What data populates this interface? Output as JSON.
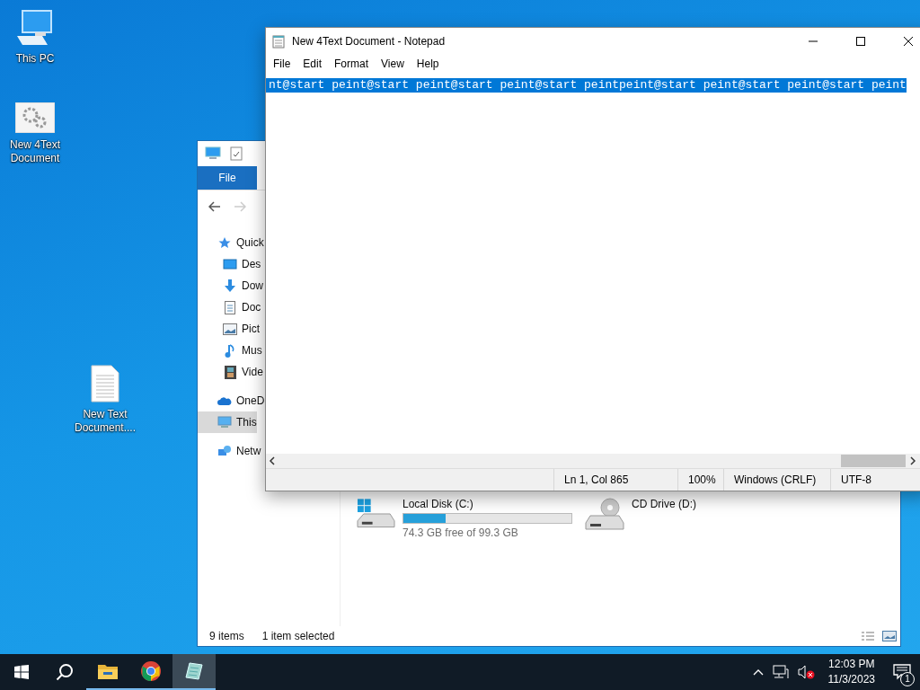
{
  "desktop_icons": [
    {
      "label": "This PC",
      "kind": "pc"
    },
    {
      "label": "New 4Text Document",
      "kind": "settings-file"
    },
    {
      "label": "New Text Document....",
      "kind": "text-file"
    }
  ],
  "explorer": {
    "ribbon_tabs": [
      {
        "label": "File",
        "selected": true
      }
    ],
    "nav_items": [
      {
        "label": "Quick",
        "kind": "star",
        "selected": false,
        "children": [
          {
            "label": "Des",
            "kind": "desktop",
            "selected": false
          },
          {
            "label": "Dow",
            "kind": "download",
            "selected": false
          },
          {
            "label": "Doc",
            "kind": "document",
            "selected": false
          },
          {
            "label": "Pict",
            "kind": "pictures",
            "selected": false
          },
          {
            "label": "Mus",
            "kind": "music",
            "selected": false
          },
          {
            "label": "Vide",
            "kind": "video",
            "selected": false
          }
        ]
      },
      {
        "label": "OneD",
        "kind": "cloud",
        "selected": false
      },
      {
        "label": "This",
        "kind": "pc",
        "selected": true
      },
      {
        "label": "Netw",
        "kind": "network",
        "selected": false
      }
    ],
    "drives": [
      {
        "name": "Local Disk (C:)",
        "kind": "disk",
        "level": 0.25,
        "free": "74.3 GB free of 99.3 GB"
      },
      {
        "name": "CD Drive (D:)",
        "kind": "cd"
      }
    ],
    "status_bar": {
      "count": "9 items",
      "selection": "1 item selected"
    }
  },
  "notepad": {
    "title": "New 4Text Document - Notepad",
    "menu": [
      "File",
      "Edit",
      "Format",
      "View",
      "Help"
    ],
    "text": "nt@start peint@start peint@start peint@start peintpeint@start peint@start peint@start peint",
    "text_selected": true,
    "status": {
      "position": "Ln 1, Col 865",
      "zoom": "100%",
      "line_ending": "Windows (CRLF)",
      "encoding": "UTF-8"
    }
  },
  "taskbar": {
    "apps": [
      {
        "kind": "explorer",
        "active": false
      },
      {
        "kind": "chrome",
        "active": false
      },
      {
        "kind": "notepad",
        "active": true
      }
    ],
    "time": "12:03 PM",
    "date": "11/3/2023",
    "notifications": "1"
  }
}
